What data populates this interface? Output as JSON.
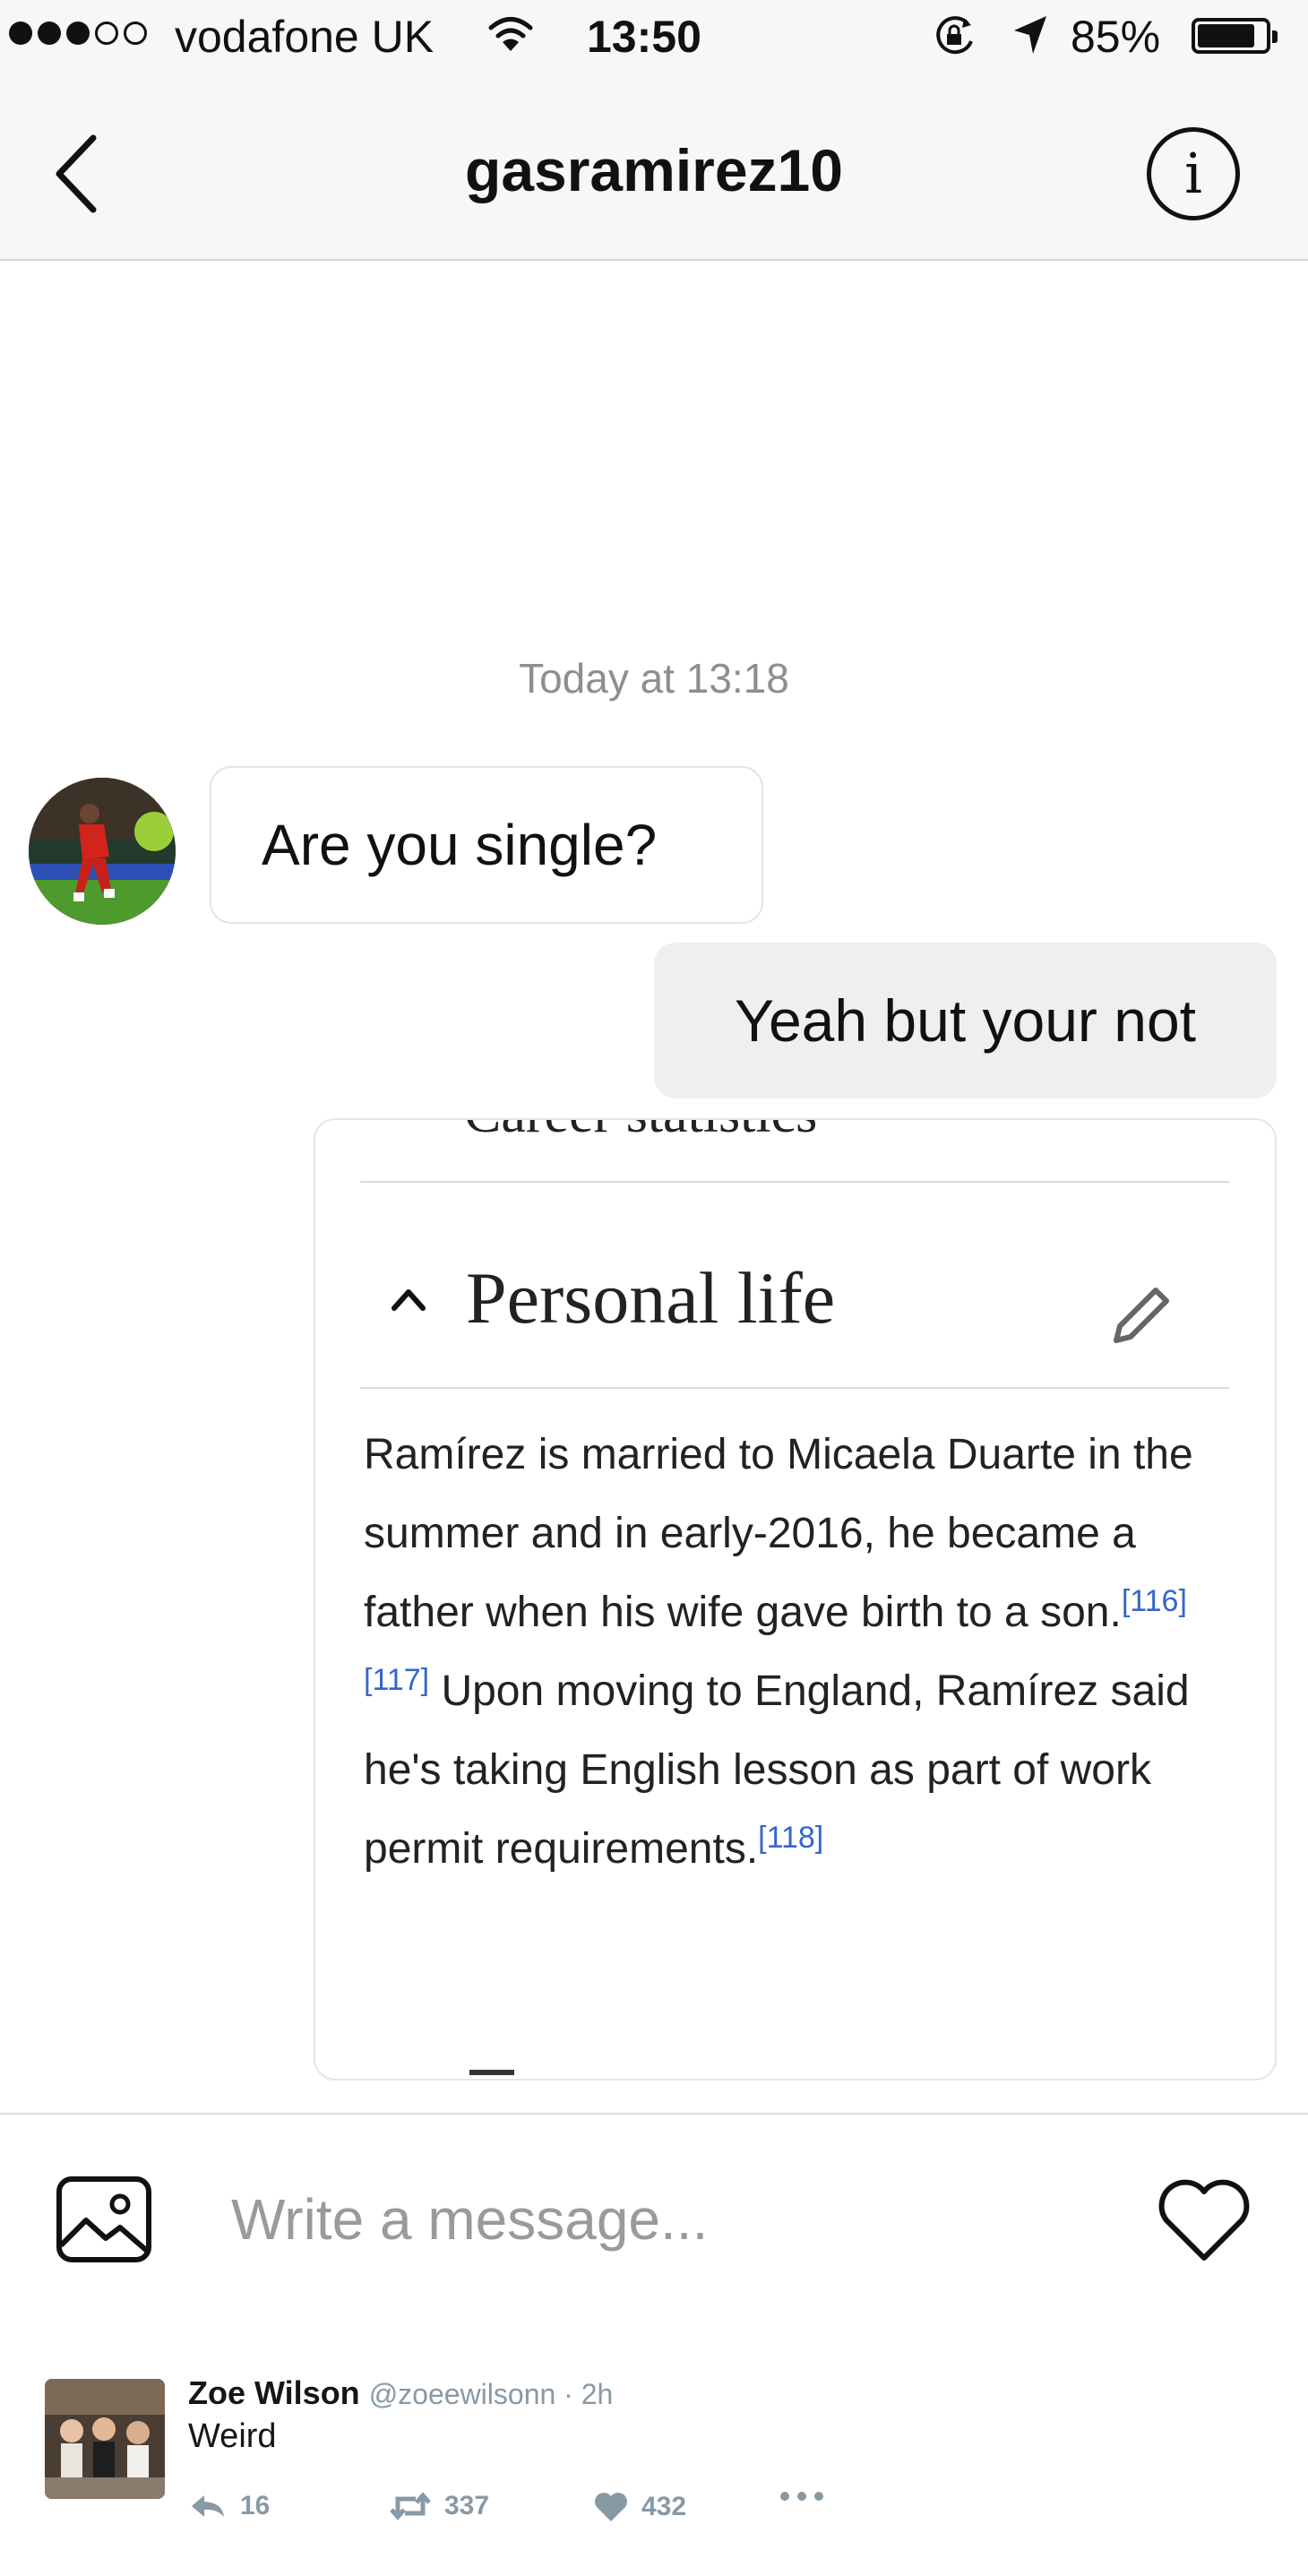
{
  "status_bar": {
    "carrier": "vodafone UK",
    "time": "13:50",
    "battery": "85%",
    "battery_level": 0.85,
    "icons": [
      "signal-dots-icon",
      "wifi-icon",
      "rotation-lock-icon",
      "location-arrow-icon",
      "battery-icon"
    ]
  },
  "header": {
    "title": "gasramirez10",
    "back_icon": "chevron-left-icon",
    "info_label": "i"
  },
  "chat": {
    "timestamp": "Today at 13:18",
    "messages": [
      {
        "direction": "incoming",
        "text": "Are you single?"
      },
      {
        "direction": "outgoing",
        "text": "Yeah but your not"
      }
    ]
  },
  "shared_card": {
    "cut_heading": "Career statistics",
    "section_title": "Personal life",
    "paragraph": {
      "part1": "Ramírez is married to Micaela Duarte in the summer and in early-2016, he became a father when his wife gave birth to a son.",
      "ref1": "[116][117]",
      "part2": " Upon moving to England, Ramírez said he's taking English lesson as part of work permit requirements.",
      "ref2": "[118]"
    }
  },
  "composer": {
    "placeholder": "Write a message...",
    "value": ""
  },
  "tweet": {
    "name": "Zoe Wilson",
    "handle": "@zoeewilsonn · 2h",
    "text": "Weird",
    "replies": "16",
    "retweets": "337",
    "likes": "432"
  },
  "colors": {
    "bar_bg": "#f7f7f7",
    "outgoing_bubble": "#efefef",
    "link_blue": "#3366cc",
    "muted": "#8e8e8e"
  }
}
